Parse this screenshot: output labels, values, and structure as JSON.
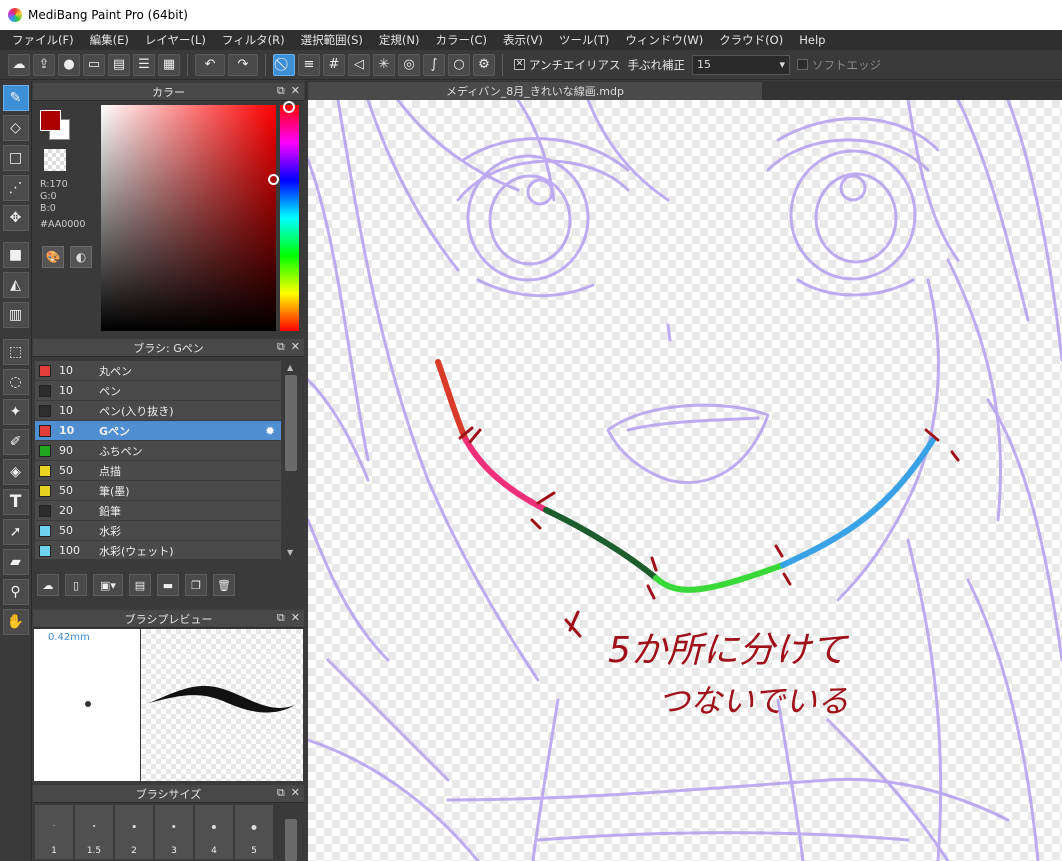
{
  "window": {
    "title": "MediBang Paint Pro (64bit)"
  },
  "menu": [
    "ファイル(F)",
    "編集(E)",
    "レイヤー(L)",
    "フィルタ(R)",
    "選択範囲(S)",
    "定規(N)",
    "カラー(C)",
    "表示(V)",
    "ツール(T)",
    "ウィンドウ(W)",
    "クラウド(O)",
    "Help"
  ],
  "toolbar": {
    "antialias_label": "アンチエイリアス",
    "antialias_checked": true,
    "stabilizer_label": "手ぶれ補正",
    "stabilizer_value": "15",
    "soft_edge_label": "ソフトエッジ",
    "soft_edge_checked": false
  },
  "color_panel": {
    "title": "カラー",
    "foreground": "#aa0000",
    "background": "#ffffff",
    "r": "R:170",
    "g": "G:0",
    "b": "B:0",
    "hex": "#AA0000"
  },
  "brush_panel": {
    "title": "ブラシ: Gペン",
    "brushes": [
      {
        "size": "10",
        "name": "丸ペン",
        "color": "#e43b3b"
      },
      {
        "size": "10",
        "name": "ペン",
        "color": "#2d2d2d"
      },
      {
        "size": "10",
        "name": "ペン(入り抜き)",
        "color": "#2d2d2d"
      },
      {
        "size": "10",
        "name": "Gペン",
        "color": "#e43b3b",
        "selected": true
      },
      {
        "size": "90",
        "name": "ふちペン",
        "color": "#1fa81f"
      },
      {
        "size": "50",
        "name": "点描",
        "color": "#e8d320"
      },
      {
        "size": "50",
        "name": "筆(墨)",
        "color": "#e8d320"
      },
      {
        "size": "20",
        "name": "鉛筆",
        "color": "#2d2d2d"
      },
      {
        "size": "50",
        "name": "水彩",
        "color": "#6fd2ee"
      },
      {
        "size": "100",
        "name": "水彩(ウェット)",
        "color": "#6fd2ee"
      }
    ]
  },
  "preview_panel": {
    "title": "ブラシプレビュー",
    "size": "0.42mm"
  },
  "size_panel": {
    "title": "ブラシサイズ",
    "sizes": [
      "1",
      "1.5",
      "2",
      "3",
      "4",
      "5"
    ]
  },
  "document": {
    "tab": "メディバン_8月_きれいな線画.mdp",
    "annotation_line1": "5か所に分けて",
    "annotation_line2": "つないでいる"
  },
  "stroke_colors": [
    "#d93a2a",
    "#ee2f7a",
    "#1d5c2c",
    "#3ad93a",
    "#39a2e6"
  ],
  "sketch_color": "#b49ef0",
  "annotation_color": "#a0101a"
}
